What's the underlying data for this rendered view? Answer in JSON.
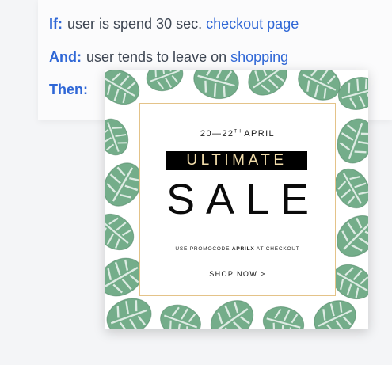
{
  "rule": {
    "if": {
      "keyword": "If:",
      "text": "user is spend 30 sec.",
      "link": "checkout page"
    },
    "and": {
      "keyword": "And:",
      "text": "user tends to leave on",
      "link": "shopping"
    },
    "then": {
      "keyword": "Then:"
    }
  },
  "banner": {
    "date_prefix": "20—22",
    "date_suffix_sup": "TH",
    "date_month": "APRIL",
    "headline_top": "ULTIMATE",
    "headline_main": "SALE",
    "promo_before": "USE PROMOCODE",
    "promo_code": "APRILX",
    "promo_after": "AT CHECKOUT",
    "cta": "SHOP NOW >"
  },
  "colors": {
    "keyword_blue": "#2f67d6",
    "text_gray": "#3d4552",
    "gold_border": "#e4c389",
    "headline_gold": "#f1dcaa",
    "leaf_green": "#3f8a5b"
  }
}
